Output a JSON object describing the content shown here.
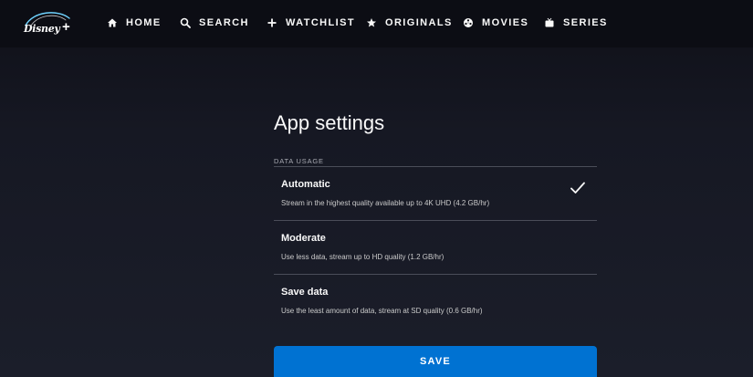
{
  "nav": {
    "logo_text": "Disney",
    "logo_plus": "+",
    "items": [
      {
        "label": "HOME",
        "icon": "home-icon"
      },
      {
        "label": "SEARCH",
        "icon": "search-icon"
      },
      {
        "label": "WATCHLIST",
        "icon": "plus-icon"
      },
      {
        "label": "ORIGINALS",
        "icon": "star-icon"
      },
      {
        "label": "MOVIES",
        "icon": "film-reel-icon"
      },
      {
        "label": "SERIES",
        "icon": "tv-icon"
      }
    ]
  },
  "settings": {
    "title": "App settings",
    "section_label": "DATA USAGE",
    "selected": "Automatic",
    "options": [
      {
        "name": "Automatic",
        "description": "Stream in the highest quality available up to 4K UHD (4.2 GB/hr)"
      },
      {
        "name": "Moderate",
        "description": "Use less data, stream up to HD quality (1.2 GB/hr)"
      },
      {
        "name": "Save data",
        "description": "Use the least amount of data, stream at SD quality (0.6 GB/hr)"
      }
    ],
    "save_label": "SAVE"
  },
  "colors": {
    "accent": "#0072d2",
    "background": "#1a1d29",
    "text": "#f9f9f9"
  }
}
